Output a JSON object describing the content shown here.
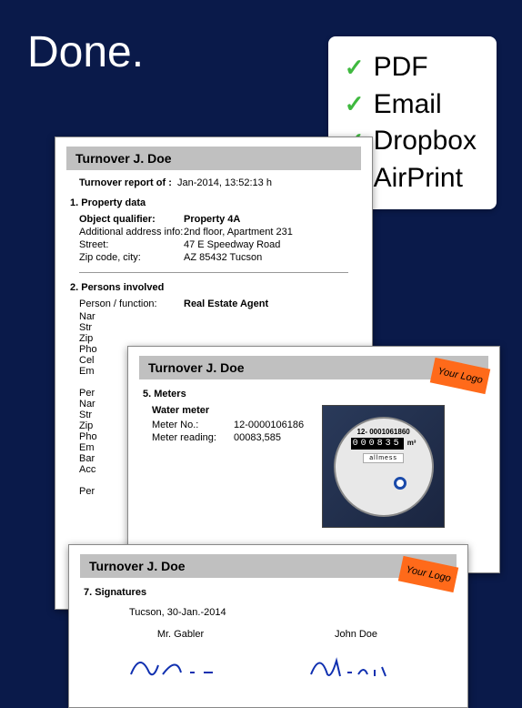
{
  "headline": "Done.",
  "features": {
    "items": [
      "PDF",
      "Email",
      "Dropbox",
      "AirPrint"
    ]
  },
  "logo_badge": "Your\nLogo",
  "doc1": {
    "title": "Turnover J. Doe",
    "report_label": "Turnover report of :",
    "report_value": "Jan-2014, 13:52:13 h",
    "section1": "1. Property data",
    "property": {
      "qualifier_label": "Object qualifier:",
      "qualifier_value": "Property 4A",
      "addr_label": "Additional address info:",
      "addr_value": "2nd floor, Apartment 231",
      "street_label": "Street:",
      "street_value": "47 E Speedway Road",
      "zip_label": "Zip code, city:",
      "zip_value": "AZ 85432 Tucson"
    },
    "section2": "2. Persons involved",
    "person_role_label": "Person / function:",
    "person_role_value": "Real Estate Agent",
    "truncated_labels": [
      "Nar",
      "Str",
      "Zip",
      "Pho",
      "Cel",
      "Em",
      "",
      "Per",
      "Nar",
      "Str",
      "Zip",
      "Pho",
      "Em",
      "Bar",
      "Acc",
      "",
      "Per"
    ]
  },
  "doc2": {
    "title": "Turnover J. Doe",
    "section": "5. Meters",
    "meter_name": "Water meter",
    "meter_no_label": "Meter No.:",
    "meter_no_value": "12-0000106186",
    "reading_label": "Meter reading:",
    "reading_value": "00083,585",
    "photo": {
      "serial": "12- 0001061860",
      "counter": "000835",
      "unit": "m³",
      "brand": "allmess"
    }
  },
  "doc3": {
    "title": "Turnover J. Doe",
    "section": "7. Signatures",
    "place_date": "Tucson, 30-Jan.-2014",
    "signer1": "Mr. Gabler",
    "signer2": "John Doe"
  }
}
